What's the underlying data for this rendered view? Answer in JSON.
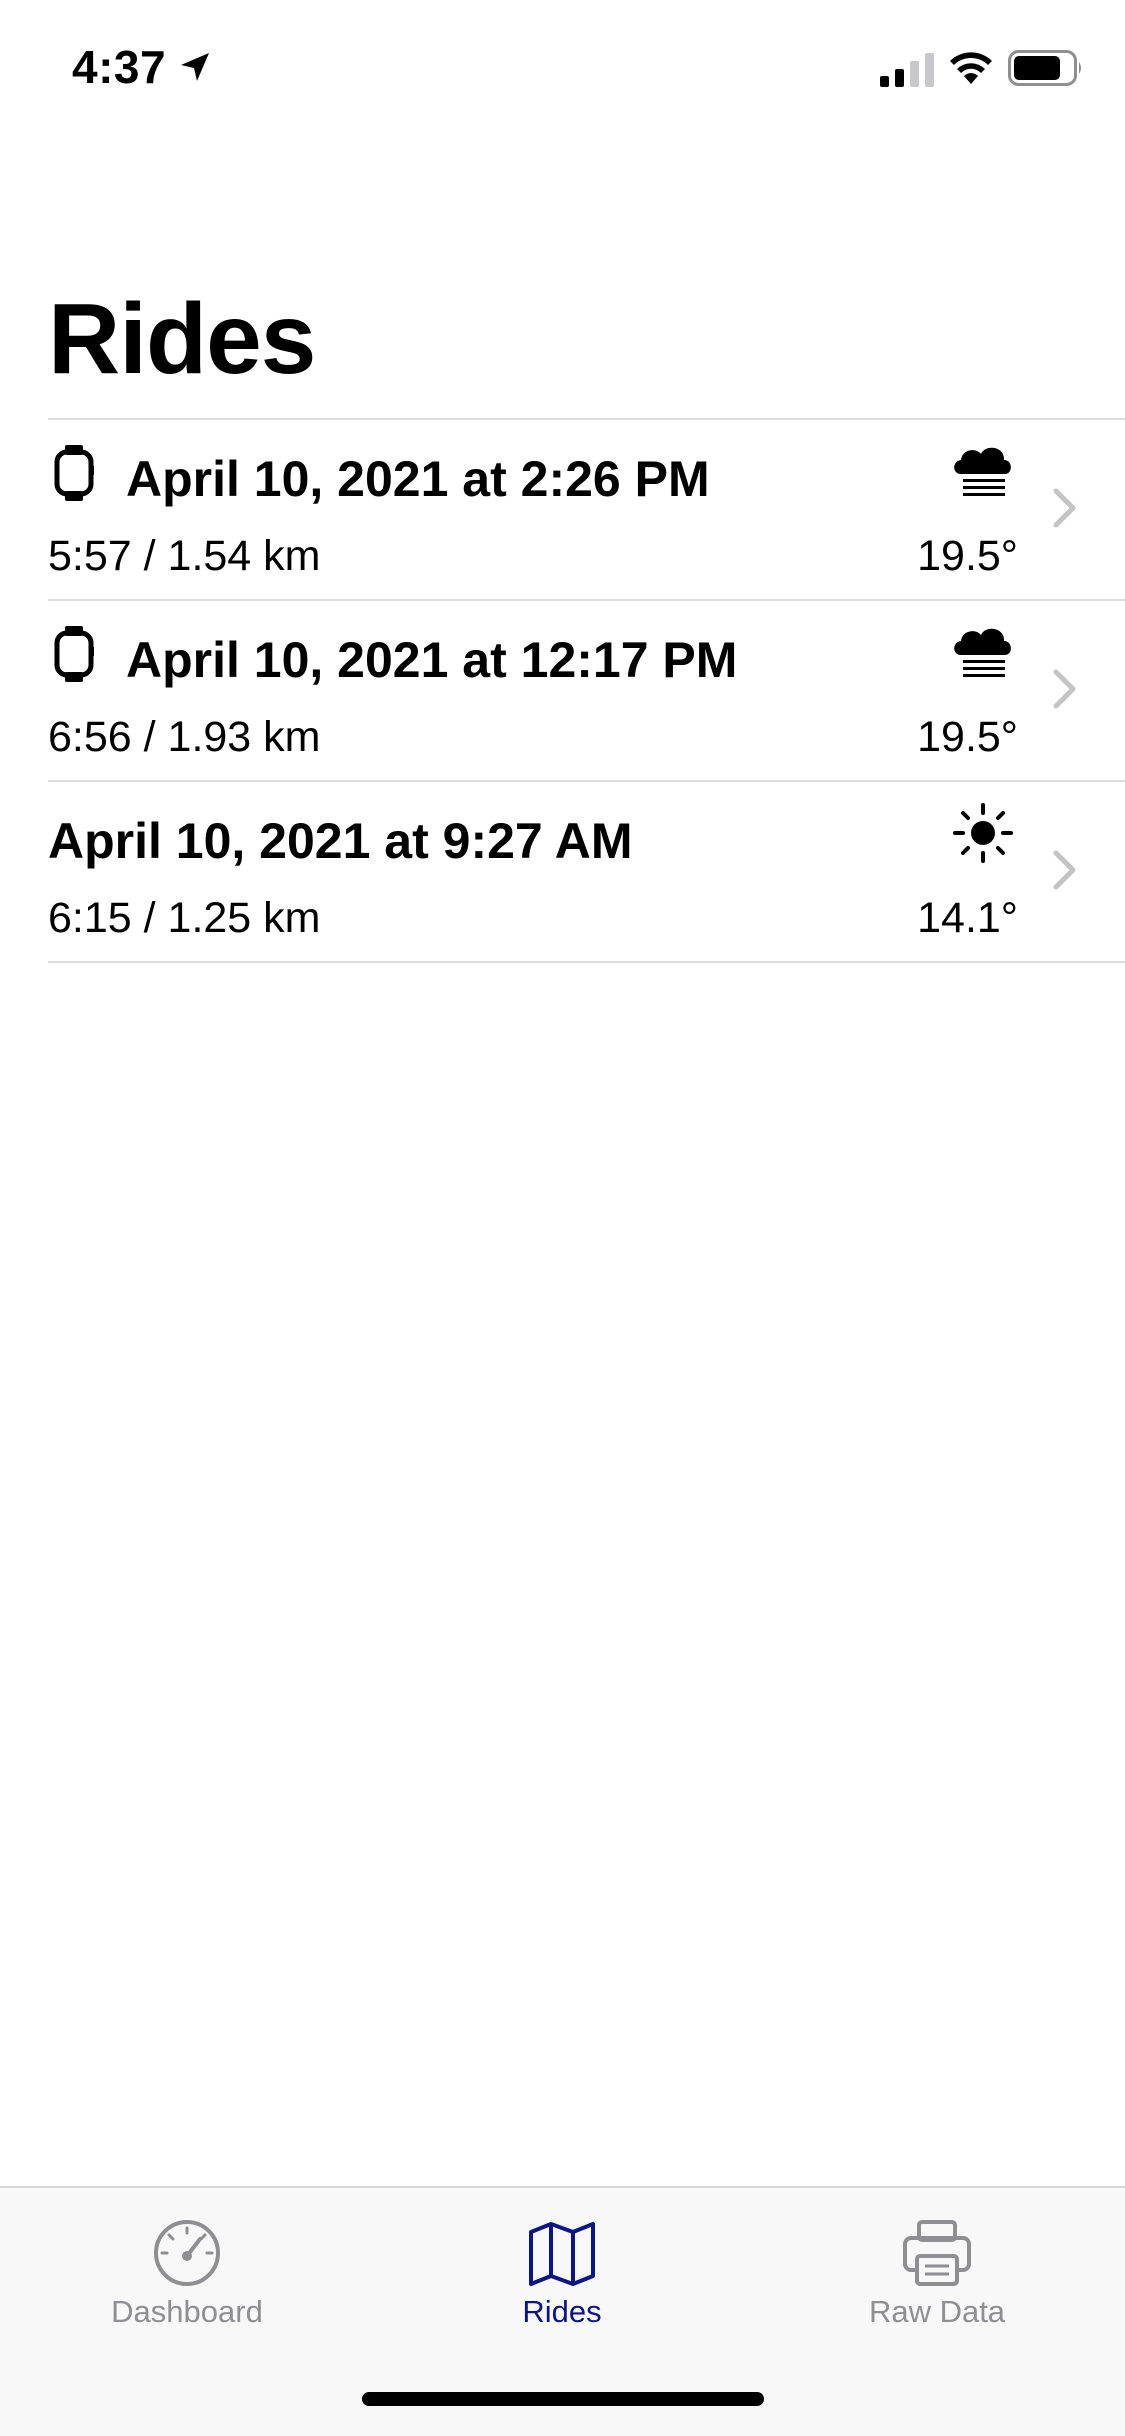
{
  "status_bar": {
    "time": "4:37"
  },
  "page": {
    "title": "Rides"
  },
  "rides": [
    {
      "title": "April 10, 2021 at 2:26 PM",
      "subtitle": "5:57 / 1.54 km",
      "temperature": "19.5°",
      "weather_icon": "fog-cloud-icon",
      "has_watch": true
    },
    {
      "title": "April 10, 2021 at 12:17 PM",
      "subtitle": "6:56 / 1.93 km",
      "temperature": "19.5°",
      "weather_icon": "fog-cloud-icon",
      "has_watch": true
    },
    {
      "title": "April 10, 2021 at 9:27 AM",
      "subtitle": "6:15 / 1.25 km",
      "temperature": "14.1°",
      "weather_icon": "sun-icon",
      "has_watch": false
    }
  ],
  "tab_bar": {
    "tabs": [
      {
        "label": "Dashboard",
        "icon": "speedometer-icon",
        "active": false
      },
      {
        "label": "Rides",
        "icon": "map-icon",
        "active": true
      },
      {
        "label": "Raw Data",
        "icon": "printer-icon",
        "active": false
      }
    ]
  },
  "colors": {
    "accent": "#0b1587",
    "inactive": "#8e8e93",
    "divider": "#dcdcdf",
    "chevron": "#c4c4c7"
  }
}
